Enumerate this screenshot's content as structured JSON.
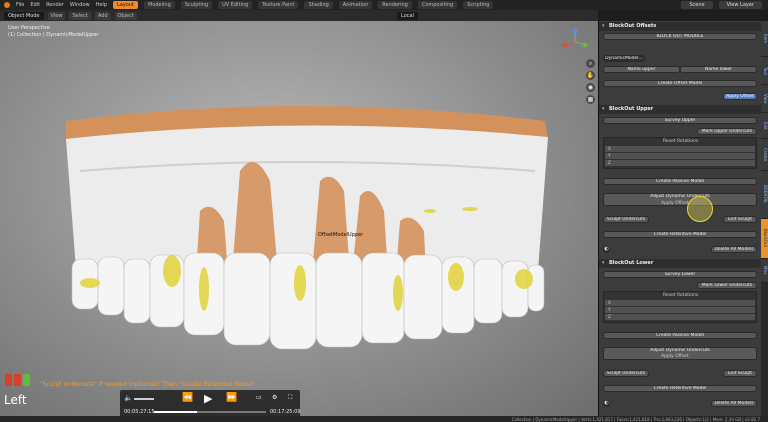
{
  "menubar": {
    "items": [
      "File",
      "Edit",
      "Render",
      "Window",
      "Help"
    ],
    "workspaces": [
      "Layout",
      "Modeling",
      "Sculpting",
      "UV Editing",
      "Texture Paint",
      "Shading",
      "Animation",
      "Rendering",
      "Compositing",
      "Scripting"
    ],
    "scene": "Scene",
    "view_layer": "View Layer"
  },
  "viewport_header": {
    "mode": "Object Mode",
    "menus": [
      "View",
      "Select",
      "Add",
      "Object"
    ],
    "orientation": "Local"
  },
  "viewport": {
    "view_info_1": "User Perspective",
    "view_info_2": "(1) Collection | DynamicModelUpper",
    "object_label": "OffsetModelUpper",
    "hint": "\"Sculpt Undercuts\" if needed (optional)! Then \"Create Retentive Model\"",
    "view_name": "Left",
    "axis_colors": [
      "#d9402c",
      "#d9402c",
      "#5bbf3a"
    ]
  },
  "player": {
    "current": "00:05:27:15",
    "total": "00:17:25:09",
    "progress": 0.38
  },
  "status": {
    "text": "Collection | DynamicModelUpper | Verts:1,421,817 | Faces:1,421,818 | Tris:2,843,236 | Objects:1/2 | Mem: 2.34 GB | v2.82.7"
  },
  "offsets": {
    "title": "BlockOut Offsets",
    "module_btn": "BLOCK OUT MODULE",
    "field": "DynamicModel...",
    "name_upper": "Name upper",
    "name_lower": "Name lower",
    "create_offset": "Create Offset Model",
    "apply_offset": "Apply Offset"
  },
  "upper": {
    "title": "BlockOut Upper",
    "survey": "Survey Upper",
    "mark_undercuts": "Mark Upper Undercuts",
    "reset_rotations": "Reset Rotations",
    "rows": [
      "X",
      "Y",
      "Z"
    ],
    "create_passive": "Create Passive Model",
    "adjust_dynamic": "Adjust Dynamic Undercuts",
    "apply_offset": "Apply Offset",
    "sculpt": "Sculpt Undercuts",
    "exit_sculpt": "Exit Sculpt",
    "create_retentive": "Create Retentive Model",
    "delete_all": "Delete All Models"
  },
  "lower": {
    "title": "BlockOut Lower",
    "survey": "Survey Lower",
    "mark_undercuts": "Mark Lower Undercuts",
    "reset_rotations": "Reset Rotations",
    "rows": [
      "X",
      "Y",
      "Z"
    ],
    "create_passive": "Create Passive Model",
    "adjust_dynamic": "Adjust Dynamic Undercuts",
    "apply_offset": "Apply Offset",
    "sculpt": "Sculpt Undercuts",
    "exit_sculpt": "Exit Sculpt",
    "create_retentive": "Create Retentive Model",
    "delete_all": "Delete All Models"
  },
  "vertical_tabs": [
    "Item",
    "Tool",
    "View",
    "Edit",
    "Create",
    "BDENTAL",
    "BlockOut",
    "Misc"
  ]
}
